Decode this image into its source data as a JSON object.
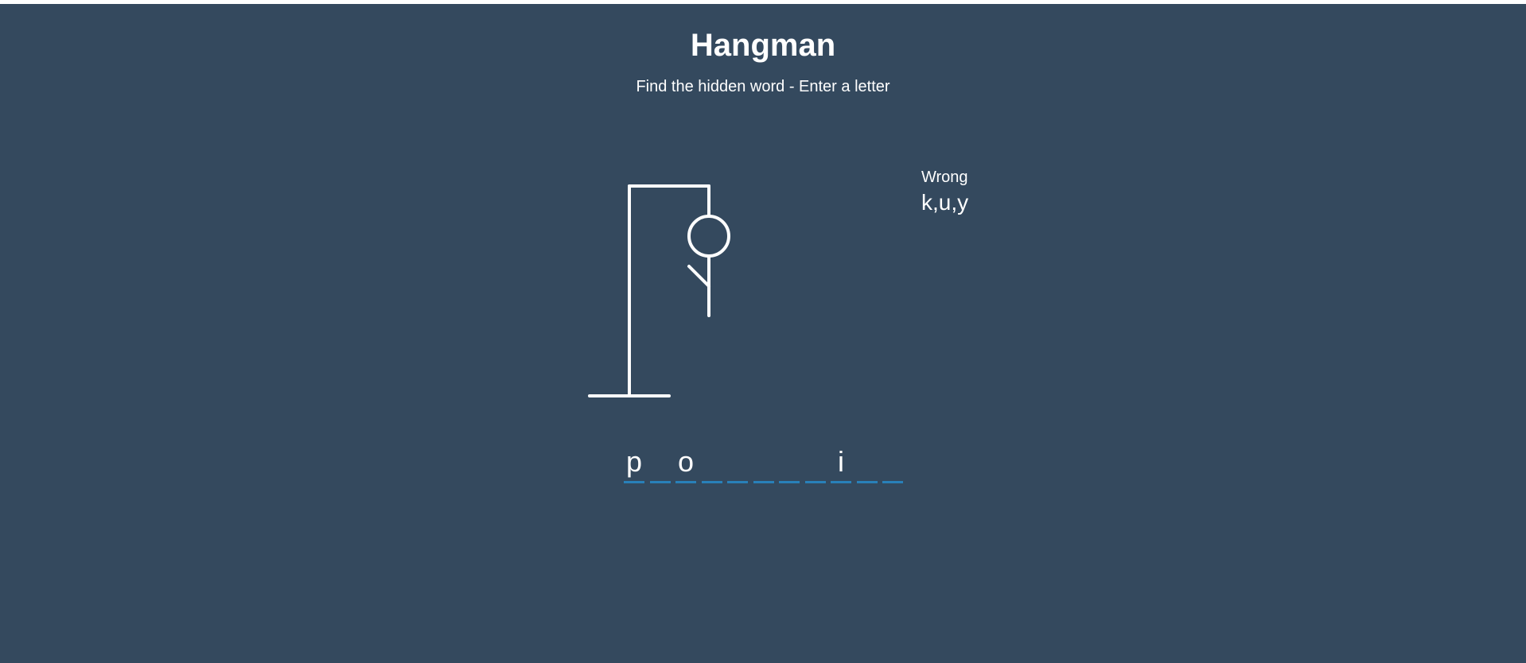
{
  "header": {
    "title": "Hangman",
    "subtitle": "Find the hidden word - Enter a letter"
  },
  "wrong": {
    "label": "Wrong",
    "letters": "k,u,y"
  },
  "word": {
    "slots": [
      "p",
      "",
      "o",
      "",
      "",
      "",
      "",
      "",
      "i",
      "",
      ""
    ]
  },
  "figure": {
    "parts_shown": [
      "head",
      "body",
      "left-arm"
    ]
  },
  "colors": {
    "background": "#34495e",
    "text": "#ffffff",
    "underline": "#2980b9",
    "drawing": "#ffffff"
  }
}
